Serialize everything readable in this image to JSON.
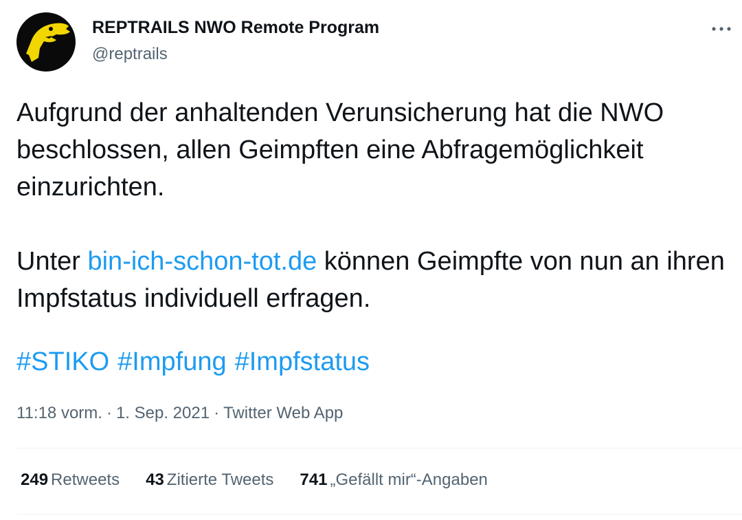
{
  "author": {
    "name": "REPTRAILS NWO Remote Program",
    "handle": "@reptrails",
    "avatar_icon": "yellow-raptor-head-icon"
  },
  "more_icon": "more-options-icon",
  "tweet": {
    "paragraph1": "Aufgrund der anhaltenden Verunsicherung hat die NWO beschlossen, allen Geimpften eine Abfragemöglichkeit einzurichten.",
    "paragraph2_prefix": "Unter ",
    "paragraph2_link": "bin-ich-schon-tot.de",
    "paragraph2_suffix": " können Geimpfte von nun an ihren Impfstatus individuell erfragen.",
    "hashtags": [
      "#STIKO",
      "#Impfung",
      "#Impfstatus"
    ]
  },
  "meta": {
    "time": "11:18 vorm.",
    "date": "1. Sep. 2021",
    "source": "Twitter Web App",
    "separator": "·"
  },
  "stats": {
    "retweets_count": "249",
    "retweets_label": "Retweets",
    "quotes_count": "43",
    "quotes_label": "Zitierte Tweets",
    "likes_count": "741",
    "likes_label": "„Gefällt mir“-Angaben"
  },
  "colors": {
    "link": "#1d9bf0",
    "secondary_text": "#536471",
    "primary_text": "#0f1419",
    "avatar_accent": "#f2d600"
  }
}
